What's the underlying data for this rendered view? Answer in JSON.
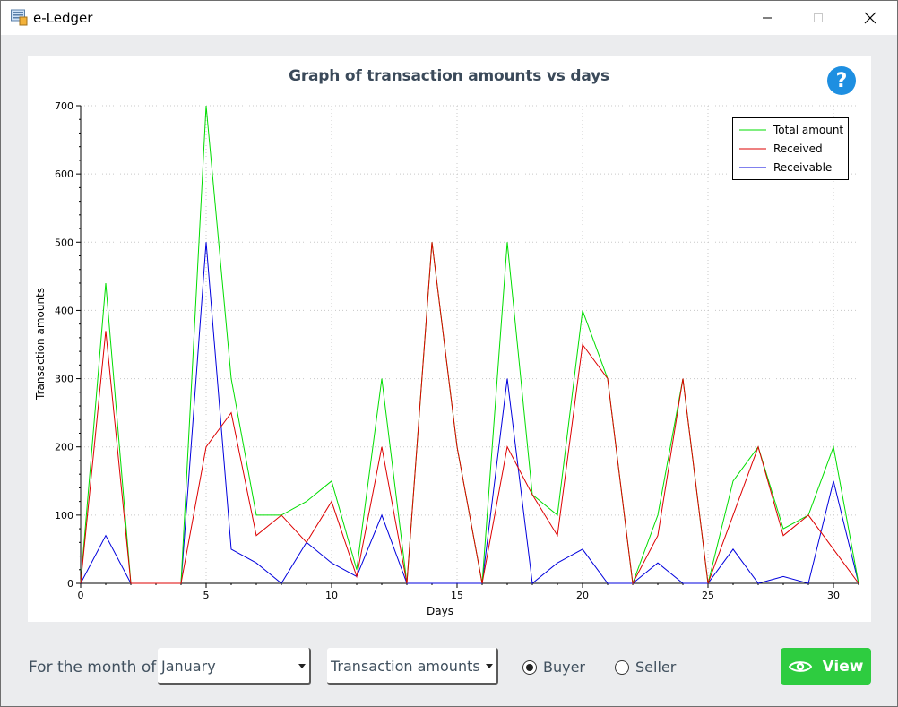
{
  "window": {
    "title": "e-Ledger"
  },
  "help": {
    "label": "?"
  },
  "chart_data": {
    "type": "line",
    "title": "Graph of transaction amounts vs days",
    "xlabel": "Days",
    "ylabel": "Transaction amounts",
    "xlim": [
      0,
      31
    ],
    "ylim": [
      0,
      700
    ],
    "xticks": [
      0,
      5,
      10,
      15,
      20,
      25,
      30
    ],
    "yticks": [
      0,
      100,
      200,
      300,
      400,
      500,
      600,
      700
    ],
    "grid": true,
    "legend_position": "top-right",
    "x": [
      0,
      1,
      2,
      3,
      4,
      5,
      6,
      7,
      8,
      9,
      10,
      11,
      12,
      13,
      14,
      15,
      16,
      17,
      18,
      19,
      20,
      21,
      22,
      23,
      24,
      25,
      26,
      27,
      28,
      29,
      30,
      31
    ],
    "series": [
      {
        "name": "Total amount",
        "color": "#00dd00",
        "values": [
          0,
          440,
          0,
          0,
          0,
          700,
          300,
          100,
          100,
          120,
          150,
          20,
          300,
          0,
          500,
          200,
          0,
          500,
          130,
          100,
          400,
          300,
          0,
          100,
          300,
          0,
          150,
          200,
          80,
          100,
          200,
          0
        ]
      },
      {
        "name": "Received",
        "color": "#dd0000",
        "values": [
          0,
          370,
          0,
          0,
          0,
          200,
          250,
          70,
          100,
          60,
          120,
          10,
          200,
          0,
          500,
          200,
          0,
          200,
          130,
          70,
          350,
          300,
          0,
          70,
          300,
          0,
          100,
          200,
          70,
          100,
          50,
          0
        ]
      },
      {
        "name": "Receivable",
        "color": "#0000dd",
        "values": [
          0,
          70,
          0,
          0,
          0,
          500,
          50,
          30,
          0,
          60,
          30,
          10,
          100,
          0,
          0,
          0,
          0,
          300,
          0,
          30,
          50,
          0,
          0,
          30,
          0,
          0,
          50,
          0,
          10,
          0,
          150,
          0
        ]
      }
    ]
  },
  "controls": {
    "month_label": "For the month of",
    "month_value": "January",
    "type_value": "Transaction amounts",
    "buyer_label": "Buyer",
    "seller_label": "Seller",
    "selected_role": "Buyer",
    "view_label": "View"
  }
}
